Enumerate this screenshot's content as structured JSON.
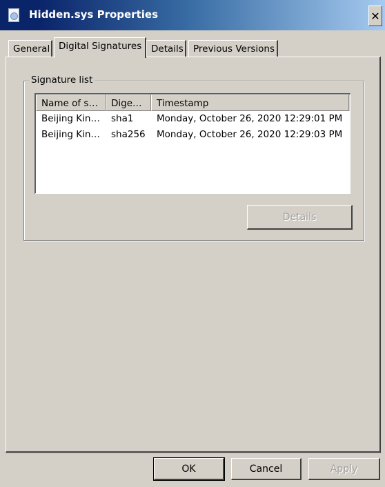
{
  "window": {
    "title": "Hidden.sys Properties",
    "icon": "system-file-icon",
    "close_label": "✕"
  },
  "tabs": [
    {
      "label": "General",
      "active": false
    },
    {
      "label": "Digital Signatures",
      "active": true
    },
    {
      "label": "Details",
      "active": false
    },
    {
      "label": "Previous Versions",
      "active": false
    }
  ],
  "signature_list": {
    "group_label": "Signature list",
    "columns": [
      "Name of s…",
      "Dige…",
      "Timestamp"
    ],
    "rows": [
      {
        "name": "Beijing Kin…",
        "digest": "sha1",
        "timestamp": "Monday, October 26, 2020 12:29:01 PM"
      },
      {
        "name": "Beijing Kin…",
        "digest": "sha256",
        "timestamp": "Monday, October 26, 2020 12:29:03 PM"
      }
    ],
    "details_label": "Details"
  },
  "footer": {
    "ok_label": "OK",
    "cancel_label": "Cancel",
    "apply_label": "Apply"
  }
}
